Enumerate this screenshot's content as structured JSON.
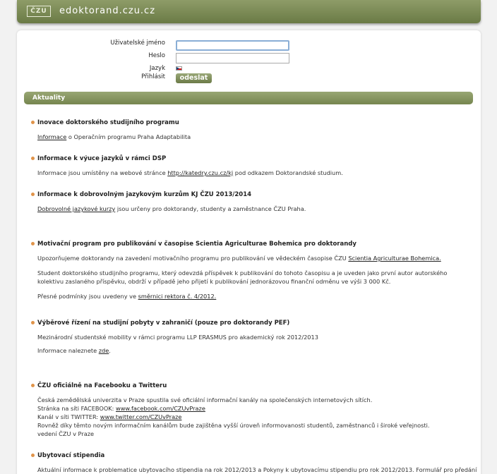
{
  "header": {
    "logo_text": "ČZU",
    "site_title": "edoktorand.czu.cz"
  },
  "login": {
    "username_label": "Uživatelské jméno",
    "password_label": "Heslo",
    "language_label": "Jazyk",
    "login_label": "Přihlásit",
    "username_value": "",
    "password_value": "",
    "submit_label": "odeslat"
  },
  "news": {
    "section_title": "Aktuality",
    "items": [
      {
        "title": "Inovace doktorského studijního programu",
        "link": "Informace",
        "text_after": " o Operačním programu Praha Adaptabilita"
      },
      {
        "title": "Informace k výuce jazyků v rámci DSP",
        "text_before": "Informace jsou umístěny na webové stránce ",
        "link": "http://katedry.czu.cz/kj",
        "text_after": " pod odkazem Doktorandské studium."
      },
      {
        "title": "Informace k dobrovolným jazykovým kurzům KJ ČZU 2013/2014",
        "link": "Dobrovolné jazykové kurzy",
        "text_after": " jsou určeny pro doktorandy, studenty a zaměstnance ČZU Praha."
      },
      {
        "title": "Motivační program pro publikování v časopise Scientia Agriculturae Bohemica pro doktorandy",
        "p1_before": "Upozorňujeme doktorandy na zavedení motivačního programu pro publikování ve vědeckém časopise ČZU ",
        "p1_link": "Scientia Agriculturae Bohemica.",
        "p2": "Student doktorského studijního programu, který odevzdá příspěvek k publikování do tohoto časopisu a je uveden jako první autor autorského kolektivu zaslaného příspěvku, obdrží v případě jeho přijetí k publikování jednorázovou finanční odměnu ve výši 3 000 Kč.",
        "p3_before": "Přesné podmínky jsou uvedeny ve ",
        "p3_link": "směrnici rektora č. 4/2012."
      },
      {
        "title": "Výběrové řízení na studijní pobyty v zahraničí (pouze pro doktorandy PEF)",
        "line1": "Mezinárodní studentské mobility v rámci programu LLP ERASMUS pro akademický rok 2012/2013",
        "line2_before": "Informace naleznete ",
        "line2_link": "zde",
        "line2_after": "."
      },
      {
        "title": "ČZU oficiálně na Facebooku a Twitteru",
        "line1": "Česká zemědělská univerzita v Praze spustila své oficiální informační kanály na společenských internetových sítích.",
        "line2_before": "Stránka na síti FACEBOOK: ",
        "line2_link": "www.facebook.com/CZUvPraze ",
        "line3_before": "Kanál v síti TWITTER: ",
        "line3_link": "www.twitter.com/CZUvPraze ",
        "line4": "Rovněž díky těmto novým informačním kanálům bude zajištěna vyšší úroveň informovanosti studentů, zaměstnanců i široké veřejnosti.",
        "line5": "vedení ČZU v Praze"
      },
      {
        "title": "Ubytovací stipendia",
        "line1": "Aktuální informace k problematice ubytovacího stipendia na rok 2012/2013 a Pokyny k ubytovacímu stipendiu pro rok 2012/2013. Formulář pro předání"
      }
    ]
  }
}
